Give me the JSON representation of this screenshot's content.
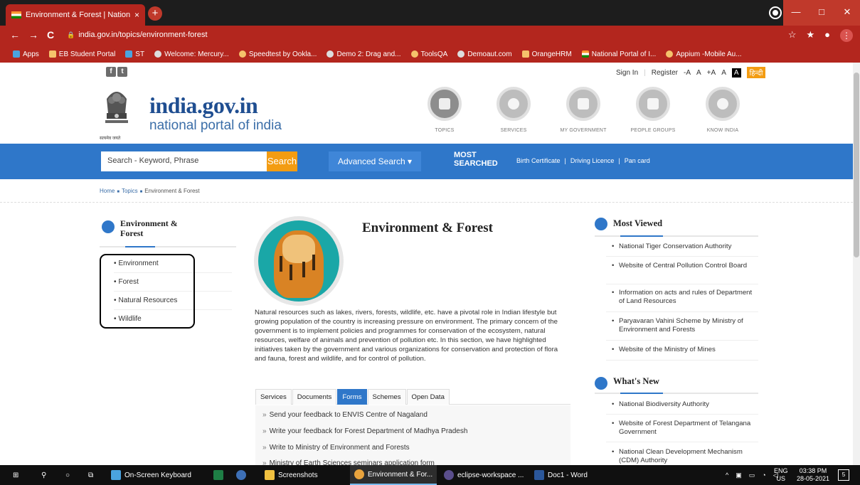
{
  "browser": {
    "tab_title": "Environment & Forest | National",
    "tab_close": "×",
    "new_tab": "+",
    "url": "india.gov.in/topics/environment-forest",
    "nav_back": "←",
    "nav_forward": "→",
    "nav_reload": "C",
    "window_min": "—",
    "window_max": "□",
    "window_close": "✕",
    "bookmarks": [
      "Apps",
      "EB Student Portal",
      "ST",
      "Welcome: Mercury...",
      "Speedtest by Ookla...",
      "Demo 2: Drag and...",
      "ToolsQA",
      "Demoaut.com",
      "OrangeHRM",
      "National Portal of I...",
      "Appium -Mobile Au..."
    ]
  },
  "topstrip": {
    "social": [
      "f",
      "t"
    ],
    "sign_in": "Sign In",
    "register": "Register",
    "font_minus": "-A",
    "font_normal": "A",
    "font_plus": "+A",
    "contrast_a": "A",
    "contrast_b": "A",
    "hindi": "हिन्दी"
  },
  "header": {
    "brand": "india.gov.in",
    "tagline": "national portal of india",
    "emblem_caption": "सत्यमेव जयते",
    "categories": [
      {
        "label": "TOPICS"
      },
      {
        "label": "SERVICES"
      },
      {
        "label": "MY GOVERNMENT"
      },
      {
        "label": "PEOPLE GROUPS"
      },
      {
        "label": "KNOW INDIA"
      }
    ]
  },
  "search": {
    "placeholder": "Search - Keyword, Phrase",
    "button": "Search",
    "advanced": "Advanced Search ▾",
    "most_searched_1": "MOST",
    "most_searched_2": "SEARCHED",
    "links": [
      "Birth Certificate",
      "|",
      "Driving Licence",
      "|",
      "Pan card"
    ]
  },
  "breadcrumb": {
    "home": "Home",
    "topics": "Topics",
    "current": "Environment & Forest"
  },
  "sidebar": {
    "title_1": "Environment &",
    "title_2": "Forest",
    "items": [
      "Environment",
      "Forest",
      "Natural Resources",
      "Wildlife"
    ]
  },
  "main": {
    "title": "Environment & Forest",
    "body": "Natural resources such as lakes, rivers, forests, wildlife, etc. have a pivotal role in Indian lifestyle but growing population of the country is increasing pressure on environment. The primary concern of the government is to implement policies and programmes for conservation of the ecosystem, natural resources, welfare of animals and prevention of pollution etc. In this section, we have highlighted initiatives taken by the government and various organizations for conservation and protection of flora and fauna, forest and wildlife, and for control of pollution.",
    "tabs": [
      "Services",
      "Documents",
      "Forms",
      "Schemes",
      "Open Data"
    ],
    "active_tab": "Forms",
    "links": [
      "Send your feedback to ENVIS Centre of Nagaland",
      "Write your feedback for Forest Department of Madhya Pradesh",
      "Write to Ministry of Environment and Forests",
      "Ministry of Earth Sciences seminars application form"
    ]
  },
  "most_viewed": {
    "title": "Most Viewed",
    "items": [
      "National Tiger Conservation Authority",
      "Website of Central Pollution Control Board",
      "Information on acts and rules of Department of Land Resources",
      "Paryavaran Vahini Scheme by Ministry of Environment and Forests",
      "Website of the Ministry of Mines"
    ]
  },
  "whats_new": {
    "title": "What's New",
    "items": [
      "National Biodiversity Authority",
      "Website of Forest Department of Telangana Government",
      "National Clean Development Mechanism (CDM) Authority"
    ]
  },
  "taskbar": {
    "items": [
      "On-Screen Keyboard",
      "Screenshots",
      "Environment & For...",
      "eclipse-workspace ...",
      "Doc1 - Word"
    ],
    "lang_1": "ENG",
    "lang_2": "US",
    "time": "03:38 PM",
    "date": "28-05-2021",
    "notif": "5"
  },
  "colors": {
    "chrome_red": "#b3261e",
    "portal_blue": "#2f77c9",
    "search_orange": "#f39c12",
    "brand_blue": "#1f4e91"
  }
}
